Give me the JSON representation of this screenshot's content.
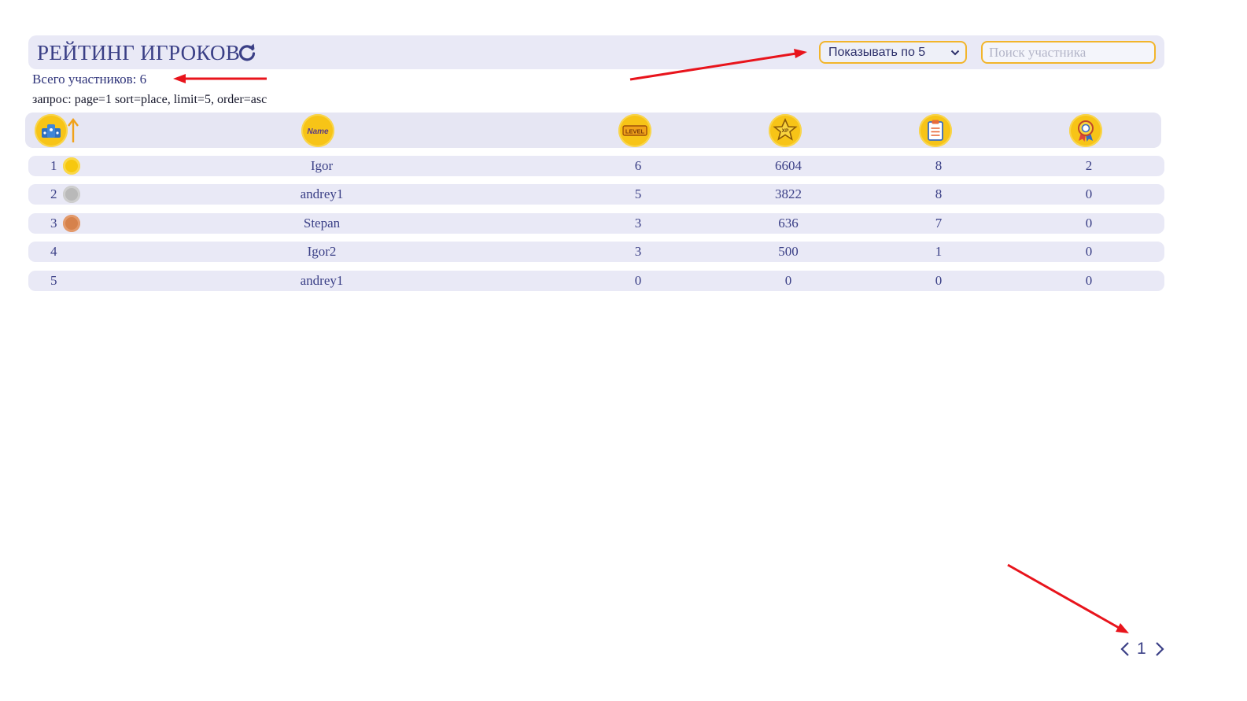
{
  "header": {
    "title": "РЕЙТИНГ ИГРОКОВ",
    "page_size_select": {
      "selected": "Показывать по 5"
    },
    "search": {
      "placeholder": "Поиск участника",
      "value": ""
    }
  },
  "total_label": "Всего участников: 6",
  "query_label": "запрос: page=1 sort=place, limit=5, order=asc",
  "columns": [
    {
      "icon": "place-icon",
      "sorted": "asc"
    },
    {
      "icon": "name-icon",
      "text": "Name"
    },
    {
      "icon": "level-icon",
      "text": "LEVEL"
    },
    {
      "icon": "xp-star-icon",
      "text": "XP"
    },
    {
      "icon": "tasks-clipboard-icon"
    },
    {
      "icon": "achievement-badge-icon"
    }
  ],
  "rows": [
    {
      "place": "1",
      "medal": "gold",
      "name": "Igor",
      "level": "6",
      "xp": "6604",
      "tasks": "8",
      "achievements": "2"
    },
    {
      "place": "2",
      "medal": "silver",
      "name": "andrey1",
      "level": "5",
      "xp": "3822",
      "tasks": "8",
      "achievements": "0"
    },
    {
      "place": "3",
      "medal": "bronze",
      "name": "Stepan",
      "level": "3",
      "xp": "636",
      "tasks": "7",
      "achievements": "0"
    },
    {
      "place": "4",
      "medal": "",
      "name": "Igor2",
      "level": "3",
      "xp": "500",
      "tasks": "1",
      "achievements": "0"
    },
    {
      "place": "5",
      "medal": "",
      "name": "andrey1",
      "level": "0",
      "xp": "0",
      "tasks": "0",
      "achievements": "0"
    }
  ],
  "pagination": {
    "current_page": "1"
  },
  "colors": {
    "accent": "#3a3f86",
    "gold": "#f7c417",
    "silver": "#b9b9b9",
    "bronze": "#d6824c",
    "annotation_arrow": "#e8141c",
    "row_bg": "#e9e9f6"
  }
}
